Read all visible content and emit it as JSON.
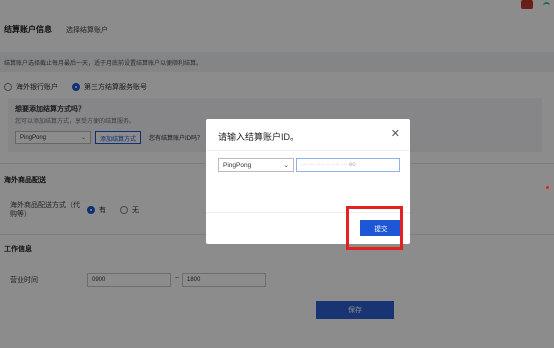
{
  "header": {
    "title": "结算账户信息",
    "subtitle": "选择结算账户"
  },
  "notice": "结算账户选择截止每月最后一天，适于月底前设置结算账户以便顺利结算。",
  "account_type": {
    "options": [
      {
        "label": "海外银行账户",
        "selected": false
      },
      {
        "label": "第三方结算服务账号",
        "selected": true
      }
    ]
  },
  "add_method": {
    "question": "想要添加结算方式吗？",
    "hint": "您可以添加结算方式，享受方便的结算服务。",
    "select_value": "PingPong",
    "add_button": "添加结算方式",
    "help_text": "您有结算账户ID吗？"
  },
  "overseas_delivery": {
    "section_title": "海外商品配送",
    "field_label": "海外商品配送方式（代购等）",
    "options": [
      {
        "label": "有",
        "selected": true
      },
      {
        "label": "无",
        "selected": false
      }
    ]
  },
  "work_info": {
    "section_title": "工作信息",
    "field_label": "营业时间",
    "start": "0900",
    "separator": "~",
    "end": "1800"
  },
  "save_button": "保存",
  "modal": {
    "title": "请输入结算账户ID。",
    "provider": "PingPong",
    "account_id": "··· ··· ···· ·· ···· ··· eo",
    "submit": "提交"
  },
  "colors": {
    "primary": "#1e57d6",
    "highlight": "#e32121"
  }
}
